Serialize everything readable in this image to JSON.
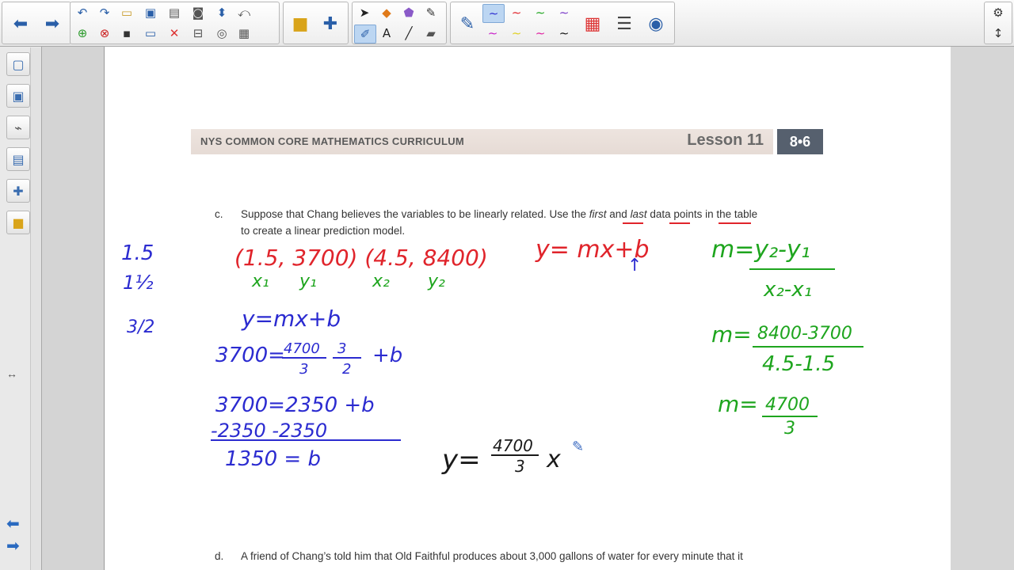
{
  "toolbar": {
    "icons": [
      "back-arrow",
      "forward-arrow",
      "undo",
      "redo",
      "open-file",
      "screen-capture",
      "paste",
      "camera",
      "clear-page",
      "redo-page",
      "add-page",
      "delete-page",
      "save",
      "display",
      "delete",
      "screen-shade",
      "capture",
      "table",
      "gallery",
      "puzzle",
      "select",
      "shapes",
      "fill",
      "magic-pen",
      "pens",
      "text",
      "line",
      "eraser",
      "pen-thick",
      "pen-blue",
      "pen-red",
      "pen-green",
      "pen-purple",
      "pen-pink",
      "pen-yellow",
      "pen-magenta",
      "pen-black",
      "color-palette",
      "line-style",
      "fill-effects",
      "settings",
      "move-toolbar"
    ]
  },
  "sidebar": {
    "items": [
      "page-sorter",
      "gallery",
      "attachments",
      "properties",
      "add-ons",
      "lesson-activity"
    ],
    "nav": [
      "previous-page",
      "next-page"
    ]
  },
  "header": {
    "curriculum": "NYS COMMON CORE MATHEMATICS CURRICULUM",
    "lesson": "Lesson 11",
    "grade": "8•6"
  },
  "question_c": {
    "letter": "c.",
    "line1_a": "Suppose that Chang believes the variables to be linearly related.  Use the ",
    "first": "first",
    "and": " and ",
    "last": "last",
    "data": " data ",
    "points": "points",
    "line1_b": " in the table",
    "line2": "to create a linear prediction model."
  },
  "question_d": {
    "letter": "d.",
    "line1": "A friend of Chang’s told him that Old Faithful produces about 3,000 gallons of water for every minute that it"
  },
  "handwriting": {
    "left_margin": [
      "1.5",
      "1½",
      "3/2"
    ],
    "points": "(1.5, 3700) (4.5, 8400)",
    "labels": [
      "x₁",
      "y₁",
      "x₂",
      "y₂"
    ],
    "form_red": "y= mx+b",
    "form_blue": "y=mx+b",
    "sub_num": "4700",
    "sub_den": "3",
    "frac2_num": "3",
    "frac2_den": "2",
    "sub_lhs": "3700=",
    "sub_rhs": "+b",
    "step2": "3700=2350 +b",
    "step3": "-2350  -2350",
    "result_b": "1350 = b",
    "slope_formula_num": "m=y₂-y₁",
    "slope_formula_den": "x₂-x₁",
    "slope_num": "8400-3700",
    "slope_den": "4.5-1.5",
    "slope_lhs": "m=",
    "slope_result_num": "4700",
    "slope_result_den": "3",
    "final_lhs": "y=",
    "final_num": "4700",
    "final_den": "3",
    "final_x": "x"
  },
  "colors": {
    "ink_red": "#e0242b",
    "ink_blue": "#2b2bd0",
    "ink_green": "#1ea51e",
    "ink_black": "#1a1a1a",
    "badge": "#56606e"
  }
}
